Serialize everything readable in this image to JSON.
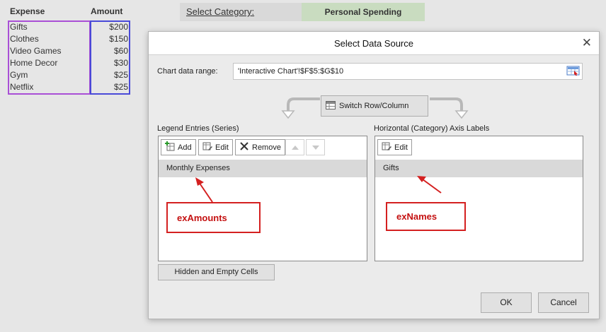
{
  "sheet": {
    "col_expense": "Expense",
    "col_amount": "Amount",
    "rows": [
      {
        "name": "Gifts",
        "amount": "$200"
      },
      {
        "name": "Clothes",
        "amount": "$150"
      },
      {
        "name": "Video Games",
        "amount": "$60"
      },
      {
        "name": "Home Decor",
        "amount": "$30"
      },
      {
        "name": "Gym",
        "amount": "$25"
      },
      {
        "name": "Netflix",
        "amount": "$25"
      }
    ],
    "category_label": "Select Category:",
    "category_value": "Personal Spending"
  },
  "dialog": {
    "title": "Select Data Source",
    "close": "✕",
    "range_label": "Chart data range:",
    "range_value": "'Interactive Chart'!$F$5:$G$10",
    "switch_label": "Switch Row/Column",
    "legend_label": "Legend Entries (Series)",
    "axis_label": "Horizontal (Category) Axis Labels",
    "add": "Add",
    "edit": "Edit",
    "remove": "Remove",
    "axis_edit": "Edit",
    "series_item": "Monthly Expenses",
    "axis_item": "Gifts",
    "hidden_cells": "Hidden and Empty Cells",
    "ok": "OK",
    "cancel": "Cancel"
  },
  "annotations": {
    "amounts": "exAmounts",
    "names": "exNames"
  },
  "colors": {
    "annotation_red": "#d42020",
    "expense_border": "#a94fd6",
    "amount_border": "#4a4ad8",
    "category_fill": "#c9dcc0"
  }
}
